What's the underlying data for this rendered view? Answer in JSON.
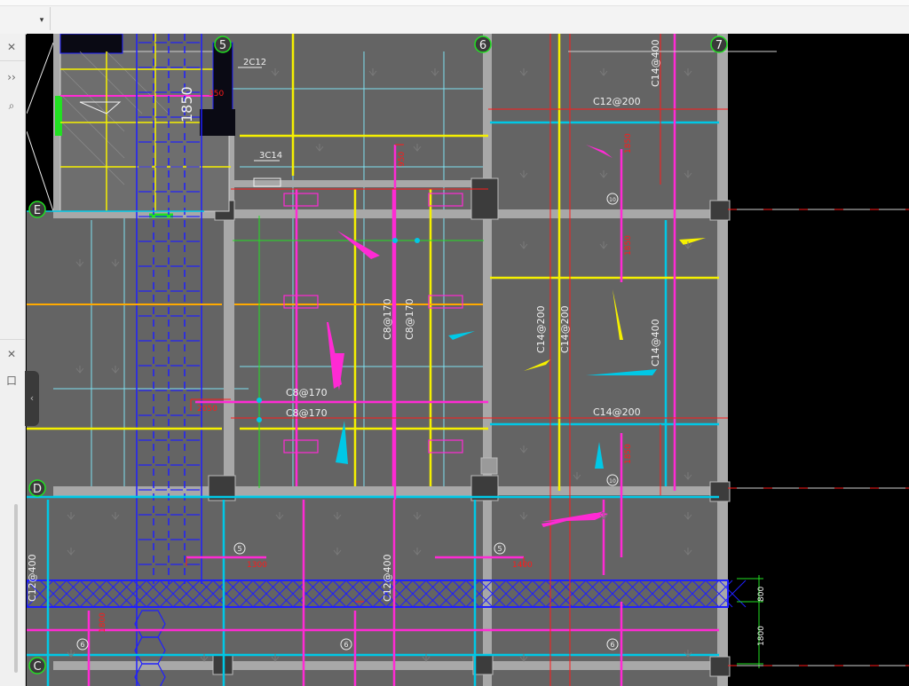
{
  "toolbar": {
    "dropdown_icon": "▾"
  },
  "left_panel": {
    "close_1": "✕",
    "expand": "››",
    "search": "⌕",
    "close_2": "✕",
    "tab": "口",
    "collapse": "‹"
  },
  "grid_labels": {
    "g6": "6",
    "g7": "7",
    "gE": "E",
    "gD": "D",
    "gC": "C",
    "g5": "5"
  },
  "drawing_texts": {
    "t1850": "1850",
    "t2c12": "2C12",
    "t3c14": "3C14",
    "tc14_400_top": "C14@400",
    "tc12_200": "C12@200",
    "tc8_170_v1": "C8@170",
    "tc8_170_v2": "C8@170",
    "tc8_170_h1": "C8@170",
    "tc8_170_h2": "C8@170",
    "tc14_200_v1": "C14@200",
    "tc14_200_v2": "C14@200",
    "tc14_400_mid": "C14@400",
    "tc14_200_h": "C14@200",
    "tc12_400_left": "C12@400",
    "tc12_400_mid": "C12@400",
    "t1300": "1300",
    "t1400": "1400",
    "t800": "800",
    "t1800": "1800",
    "t950": "950",
    "t1850b": "1850",
    "t1850c": "1850",
    "t1850d": "1850",
    "t1800v": "1800",
    "t350": "350",
    "t2050": "2050",
    "c5a": "5",
    "c5b": "5",
    "c6a": "6",
    "c6b": "6",
    "c6c": "6",
    "c10a": "10",
    "c10b": "10"
  },
  "colors": {
    "bg": "#646464",
    "beam": "#a8a8a8",
    "cyan": "#00c8e6",
    "magenta": "#ff2ad4",
    "yellow": "#f5f000",
    "blue": "#1f1fff",
    "red": "#ff1a1a",
    "green": "#22e022",
    "white": "#f0f0f0",
    "orange": "#ffaa00"
  }
}
